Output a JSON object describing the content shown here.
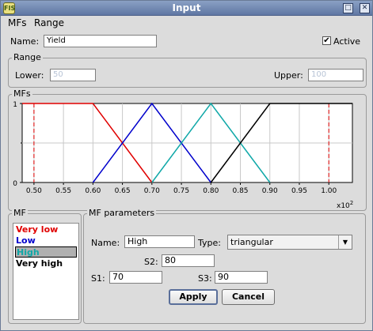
{
  "window": {
    "title": "Input",
    "icon_text": "FIS",
    "buttons": [
      "□",
      "⊠",
      "✕"
    ]
  },
  "menu": {
    "items": [
      "MFs",
      "Range"
    ]
  },
  "name_label": "Name:",
  "name_value": "Yield",
  "active_label": "Active",
  "active_checked": true,
  "range": {
    "title": "Range",
    "lower_label": "Lower:",
    "lower_value": "50",
    "upper_label": "Upper:",
    "upper_value": "100"
  },
  "mfs_group": {
    "title": "MFs"
  },
  "chart_data": {
    "type": "line",
    "xlim": [
      0.48,
      1.04
    ],
    "ylim": [
      0,
      1
    ],
    "x_ticks": [
      "0.50",
      "0.55",
      "0.60",
      "0.65",
      "0.70",
      "0.75",
      "0.80",
      "0.85",
      "0.90",
      "0.95",
      "1.00"
    ],
    "y_ticks": [
      "0",
      "1"
    ],
    "x_exponent": "x10^2",
    "range_markers": [
      0.5,
      1.0
    ],
    "series": [
      {
        "name": "Very low",
        "color": "#e00000",
        "points": [
          [
            0.48,
            1
          ],
          [
            0.6,
            1
          ],
          [
            0.7,
            0
          ]
        ]
      },
      {
        "name": "Low",
        "color": "#0000cc",
        "points": [
          [
            0.6,
            0
          ],
          [
            0.7,
            1
          ],
          [
            0.8,
            0
          ]
        ]
      },
      {
        "name": "High",
        "color": "#10a8a8",
        "points": [
          [
            0.7,
            0
          ],
          [
            0.8,
            1
          ],
          [
            0.9,
            0
          ]
        ]
      },
      {
        "name": "Very high",
        "color": "#000000",
        "points": [
          [
            0.8,
            0
          ],
          [
            0.9,
            1
          ],
          [
            1.04,
            1
          ]
        ]
      }
    ]
  },
  "mf_list": {
    "title": "MF",
    "items": [
      {
        "label": "Very low",
        "color": "#e00000"
      },
      {
        "label": "Low",
        "color": "#0000cc"
      },
      {
        "label": "High",
        "color": "#10a8a8"
      },
      {
        "label": "Very high",
        "color": "#000000"
      }
    ],
    "selected_index": 2
  },
  "params": {
    "title": "MF parameters",
    "name_label": "Name:",
    "name_value": "High",
    "type_label": "Type:",
    "type_value": "triangular",
    "s2_label": "S2:",
    "s2_value": "80",
    "s1_label": "S1:",
    "s1_value": "70",
    "s3_label": "S3:",
    "s3_value": "90",
    "apply_label": "Apply",
    "cancel_label": "Cancel"
  }
}
